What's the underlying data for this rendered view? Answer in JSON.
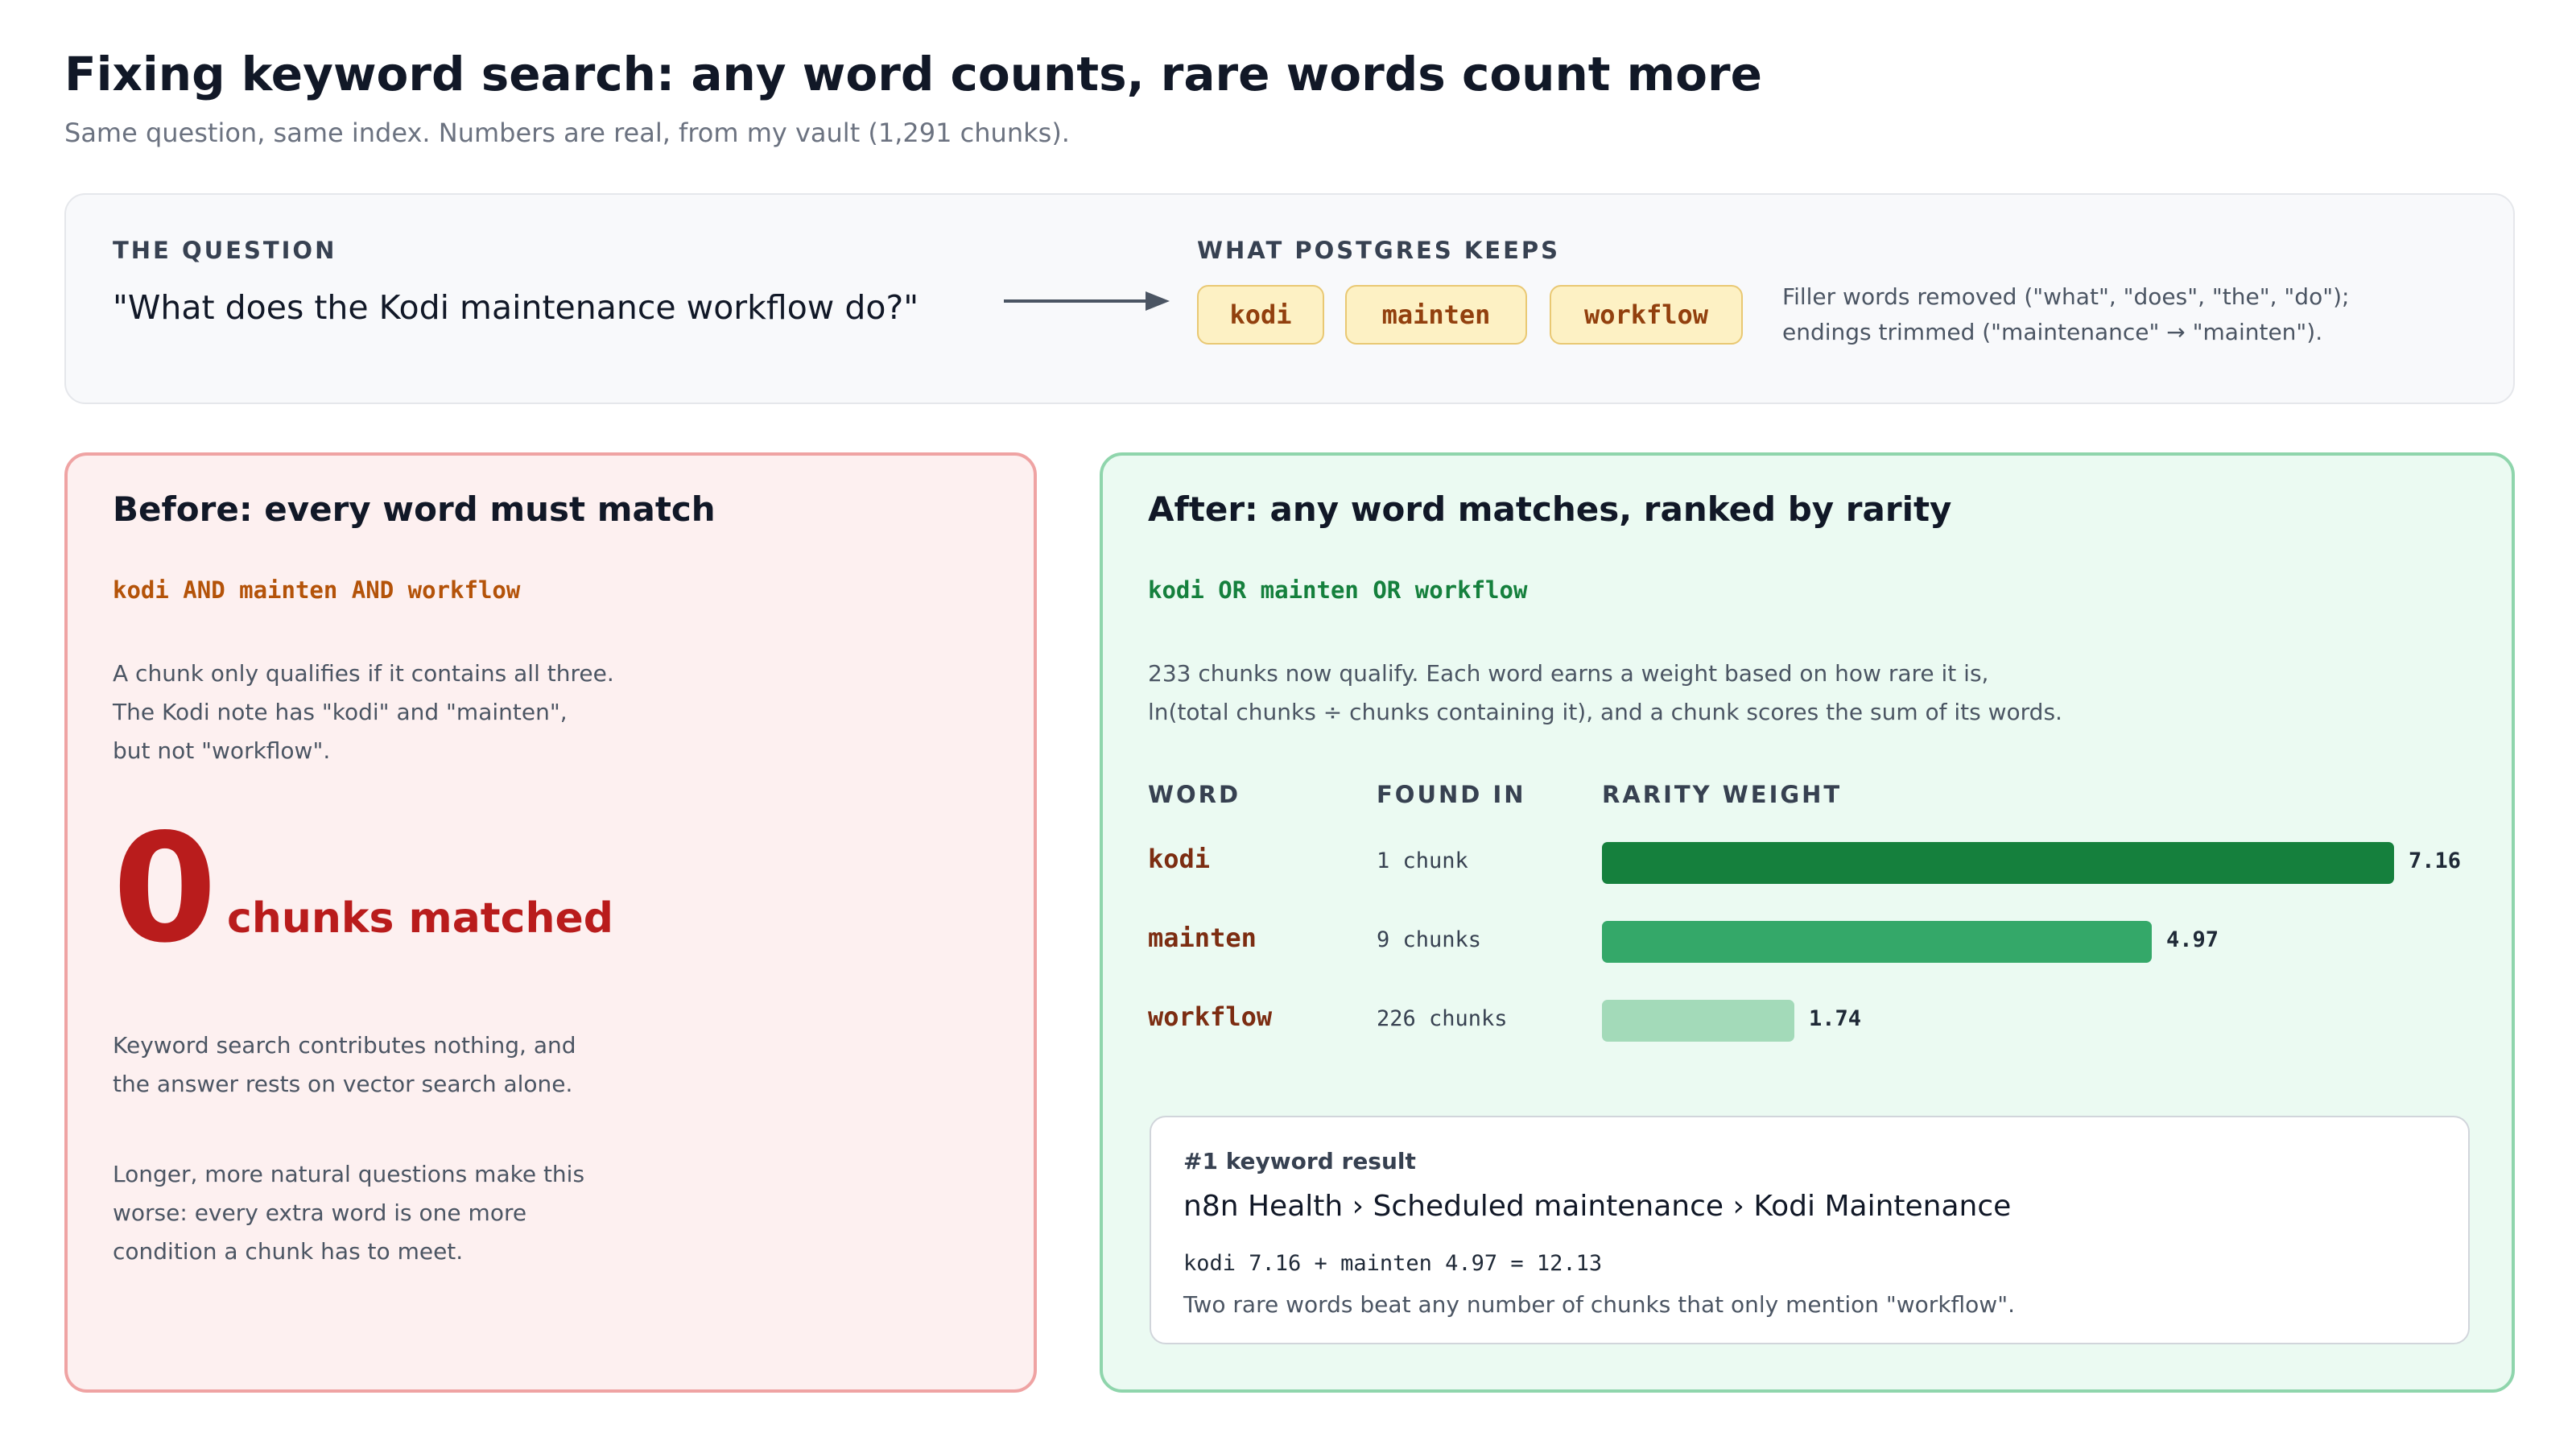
{
  "header": {
    "title": "Fixing keyword search: any word counts, rare words count more",
    "subtitle": "Same question, same index. Numbers are real, from my vault (1,291 chunks)."
  },
  "question_panel": {
    "question_label": "THE QUESTION",
    "question": "\"What does the Kodi maintenance workflow do?\"",
    "keeps_label": "WHAT POSTGRES KEEPS",
    "tokens": [
      "kodi",
      "mainten",
      "workflow"
    ],
    "filler_note": [
      "Filler words removed (\"what\", \"does\", \"the\", \"do\");",
      "endings trimmed (\"maintenance\" → \"mainten\")."
    ]
  },
  "before": {
    "title": "Before: every word must match",
    "query": "kodi AND mainten AND workflow",
    "explanation": [
      "A chunk only qualifies if it contains all three.",
      "The Kodi note has \"kodi\" and \"mainten\",",
      "but not \"workflow\"."
    ],
    "matched_count": "0",
    "matched_label": "chunks matched",
    "consequence": [
      "Keyword search contributes nothing, and",
      "the answer rests on vector search alone."
    ],
    "note": [
      "Longer, more natural questions make this",
      "worse: every extra word is one more",
      "condition a chunk has to meet."
    ]
  },
  "after": {
    "title": "After: any word matches, ranked by rarity",
    "query": "kodi OR mainten OR workflow",
    "explanation": [
      "233 chunks now qualify. Each word earns a weight based on how rare it is,",
      "ln(total chunks ÷ chunks containing it), and a chunk scores the sum of its words."
    ],
    "columns": {
      "word": "WORD",
      "found_in": "FOUND IN",
      "weight": "RARITY WEIGHT"
    },
    "result_card": {
      "heading": "#1 keyword result",
      "path": "n8n Health › Scheduled maintenance › Kodi Maintenance",
      "formula": "kodi 7.16 + mainten 4.97 = 12.13",
      "note": "Two rare words beat any number of chunks that only mention \"workflow\"."
    }
  },
  "chart_data": {
    "type": "bar",
    "orientation": "horizontal",
    "categories": [
      "kodi",
      "mainten",
      "workflow"
    ],
    "found_in": [
      "1 chunk",
      "9 chunks",
      "226 chunks"
    ],
    "values": [
      7.16,
      4.97,
      1.74
    ],
    "value_labels": [
      "7.16",
      "4.97",
      "1.74"
    ],
    "colors": [
      "#15803d",
      "#34a869",
      "#a3dab9"
    ],
    "xlim": [
      0,
      7.16
    ]
  }
}
